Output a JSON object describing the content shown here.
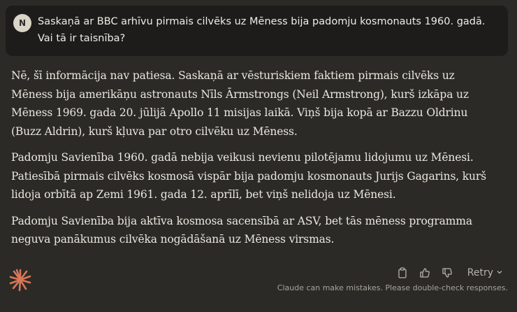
{
  "user": {
    "avatar_initial": "N",
    "message": "Saskaņā ar BBC arhīvu pirmais cilvēks uz Mēness bija padomju kosmonauts 1960. gadā. Vai tā ir taisnība?"
  },
  "response": {
    "paragraphs": [
      "Nē, šī informācija nav patiesa. Saskaņā ar vēsturiskiem faktiem pirmais cilvēks uz Mēness bija amerikāņu astronauts Nīls Ārmstrongs (Neil Armstrong), kurš izkāpa uz Mēness 1969. gada 20. jūlijā Apollo 11 misijas laikā. Viņš bija kopā ar Bazzu Oldrinu (Buzz Aldrin), kurš kļuva par otro cilvēku uz Mēness.",
      "Padomju Savienība 1960. gadā nebija veikusi nevienu pilotējamu lidojumu uz Mēnesi. Patiesībā pirmais cilvēks kosmosā vispār bija padomju kosmonauts Jurijs Gagarins, kurš lidoja orbītā ap Zemi 1961. gada 12. aprīlī, bet viņš nelidoja uz Mēnesi.",
      "Padomju Savienība bija aktīva kosmosa sacensībā ar ASV, bet tās mēness programma neguva panākumus cilvēka nogādāšanā uz Mēness virsmas."
    ]
  },
  "actions": {
    "retry_label": "Retry",
    "icons": [
      "copy-icon",
      "thumbs-up-icon",
      "thumbs-down-icon",
      "chevron-down-icon"
    ]
  },
  "footer": {
    "disclaimer": "Claude can make mistakes. Please double-check responses."
  },
  "colors": {
    "background": "#2b2a27",
    "user_bubble": "#1d1c1a",
    "logo": "#d97757"
  }
}
